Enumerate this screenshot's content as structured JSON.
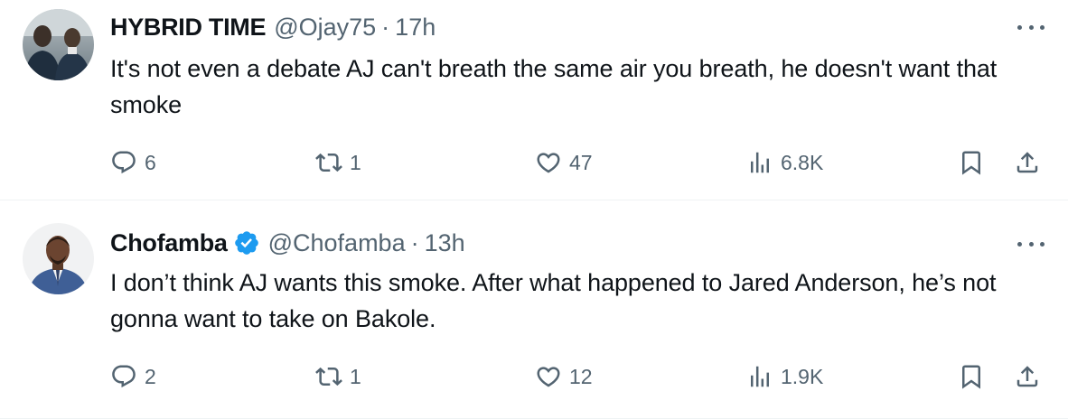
{
  "tweets": [
    {
      "display_name": "HYBRID TIME",
      "handle": "@Ojay75",
      "separator": "·",
      "time": "17h",
      "verified": false,
      "text": "It's not even a debate AJ can't breath the same air you breath, he doesn't want that smoke",
      "replies": "6",
      "reposts": "1",
      "likes": "47",
      "views": "6.8K",
      "more_icon": "more-dots-icon"
    },
    {
      "display_name": "Chofamba",
      "handle": "@Chofamba",
      "separator": "·",
      "time": "13h",
      "verified": true,
      "text": "I don’t think AJ wants this smoke. After what happened to Jared Anderson, he’s not gonna want to take on Bakole.",
      "replies": "2",
      "reposts": "1",
      "likes": "12",
      "views": "1.9K",
      "more_icon": "more-dots-icon"
    }
  ],
  "colors": {
    "text_primary": "#0f1419",
    "text_secondary": "#536471",
    "verified_blue": "#1d9bf0",
    "divider": "#eff3f4"
  },
  "icons": [
    "reply-icon",
    "repost-icon",
    "like-icon",
    "views-icon",
    "bookmark-icon",
    "share-icon",
    "verified-badge-icon"
  ]
}
